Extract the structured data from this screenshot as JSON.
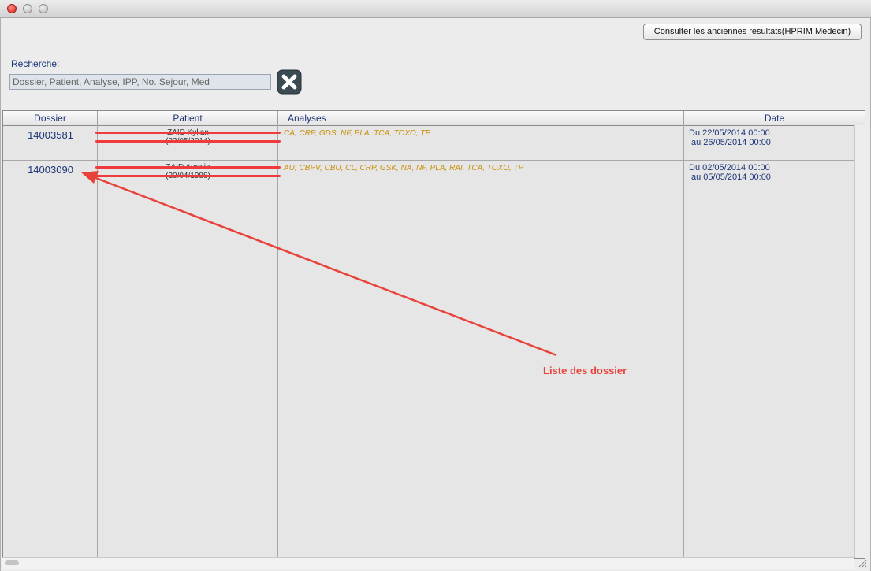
{
  "toolbar": {
    "old_results_label": "Consulter les anciennes résultats(HPRIM Medecin)"
  },
  "search": {
    "label": "Recherche:",
    "placeholder": "Dossier, Patient, Analyse, IPP, No. Sejour, Med",
    "value": ""
  },
  "table": {
    "columns": [
      "Dossier",
      "Patient",
      "Analyses",
      "Date"
    ],
    "rows": [
      {
        "dossier": "14003581",
        "patient_name": "ZAID Kylian",
        "patient_dob": "(23/05/2014)",
        "analyses": "CA, CRP, GDS, NF, PLA, TCA, TOXO, TP.",
        "date_from": "Du 22/05/2014 00:00",
        "date_to": "au 26/05/2014 00:00"
      },
      {
        "dossier": "14003090",
        "patient_name": "ZAID Aurelie",
        "patient_dob": "(20/04/1988)",
        "analyses": "AU, CBPV, CBU, CL, CRP, GSK, NA, NF, PLA, RAI, TCA, TOXO, TP",
        "date_from": "Du 02/05/2014 00:00",
        "date_to": "au 05/05/2014 00:00"
      }
    ]
  },
  "annotation": {
    "label": "Liste des dossier",
    "color": "#e8433a"
  },
  "colors": {
    "header_text": "#1d3478",
    "analyses_text": "#c9900a"
  },
  "icons": {
    "clear": "clear-x-icon",
    "window_close": "close-icon",
    "window_minimize": "minimize-icon",
    "window_zoom": "zoom-icon"
  }
}
